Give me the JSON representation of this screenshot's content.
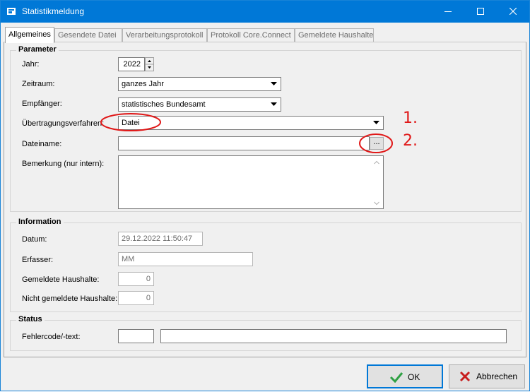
{
  "window": {
    "title": "Statistikmeldung"
  },
  "tabs": [
    {
      "label": "Allgemeines"
    },
    {
      "label": "Gesendete Datei"
    },
    {
      "label": "Verarbeitungsprotokoll"
    },
    {
      "label": "Protokoll Core.Connect"
    },
    {
      "label": "Gemeldete Haushalte"
    }
  ],
  "parameter": {
    "title": "Parameter",
    "jahr_label": "Jahr:",
    "jahr_value": "2022",
    "zeitraum_label": "Zeitraum:",
    "zeitraum_value": "ganzes Jahr",
    "empfaenger_label": "Empfänger:",
    "empfaenger_value": "statistisches Bundesamt",
    "verfahren_label": "Übertragungsverfahren:",
    "verfahren_value": "Datei",
    "dateiname_label": "Dateiname:",
    "dateiname_value": "",
    "browse_label": "...",
    "bemerkung_label": "Bemerkung (nur intern):",
    "bemerkung_value": ""
  },
  "information": {
    "title": "Information",
    "datum_label": "Datum:",
    "datum_value": "29.12.2022 11:50:47",
    "erfasser_label": "Erfasser:",
    "erfasser_value": "MM",
    "gemeldete_label": "Gemeldete Haushalte:",
    "gemeldete_value": "0",
    "nicht_gemeldete_label": "Nicht gemeldete Haushalte:",
    "nicht_gemeldete_value": "0"
  },
  "status": {
    "title": "Status",
    "fehler_label": "Fehlercode/-text:",
    "fehlercode_value": "",
    "fehlertext_value": ""
  },
  "annotations": {
    "first": "1.",
    "second": "2."
  },
  "buttons": {
    "ok": "OK",
    "cancel": "Abbrechen"
  },
  "colors": {
    "titlebar": "#0078d7",
    "annotation": "#e01818",
    "ok_check": "#2ea043",
    "cancel_x": "#c81e1e"
  },
  "icons": {
    "window": "app-icon",
    "ok": "check-icon",
    "cancel": "x-icon"
  }
}
